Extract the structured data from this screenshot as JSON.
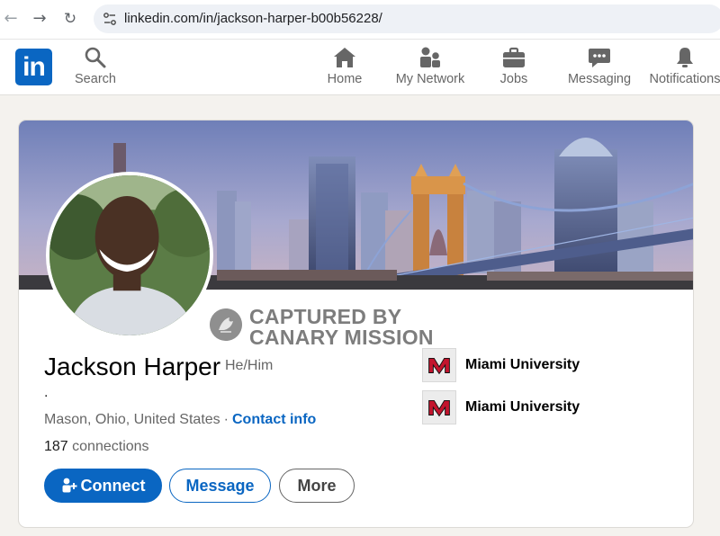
{
  "browser": {
    "url": "linkedin.com/in/jackson-harper-b00b56228/",
    "back_icon": "arrow-left-icon",
    "forward_icon": "arrow-right-icon",
    "reload_icon": "reload-icon"
  },
  "nav": {
    "logo": "in",
    "search": "Search",
    "home": "Home",
    "network": "My Network",
    "jobs": "Jobs",
    "messaging": "Messaging",
    "notifications": "Notifications"
  },
  "watermark": {
    "line1": "CAPTURED BY",
    "line2": "CANARY MISSION"
  },
  "profile": {
    "name": "Jackson Harper",
    "pronouns": "He/Him",
    "headline": ".",
    "location": "Mason, Ohio, United States",
    "separator": "·",
    "contact_info": "Contact info",
    "connections_count": "187",
    "connections_label": "connections"
  },
  "education": [
    {
      "name": "Miami University",
      "logo_letter": "M"
    },
    {
      "name": "Miami University",
      "logo_letter": "M"
    }
  ],
  "actions": {
    "connect": "Connect",
    "message": "Message",
    "more": "More"
  },
  "colors": {
    "brand": "#0a66c2",
    "miami_red": "#c3142d"
  }
}
